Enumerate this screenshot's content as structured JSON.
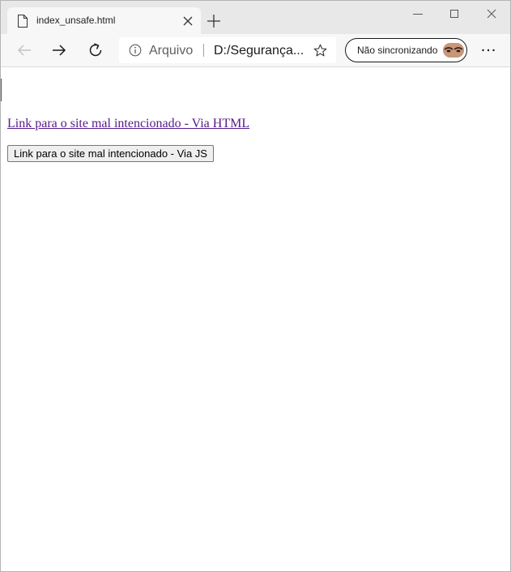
{
  "browser": {
    "tab": {
      "title": "index_unsafe.html",
      "icon": "file-icon",
      "close_icon": "close-icon"
    },
    "new_tab_icon": "plus-icon",
    "window_controls": [
      "minimize-icon",
      "maximize-icon",
      "close-icon"
    ],
    "toolbar": {
      "back_icon": "arrow-left-icon",
      "forward_icon": "arrow-right-icon",
      "refresh_icon": "refresh-icon",
      "site_info_icon": "info-icon",
      "site_label": "Arquivo",
      "url": "D:/Segurança...",
      "favorite_icon": "star-icon",
      "sync_label": "Não sincronizando",
      "more_icon": "more-icon"
    }
  },
  "page": {
    "link_text": "Link para o site mal intencionado - Via HTML",
    "button_label": "Link para o site mal intencionado - Via JS",
    "link_color": "#551a8b"
  }
}
